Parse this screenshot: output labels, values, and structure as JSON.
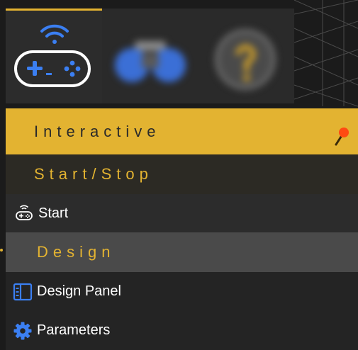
{
  "toolbar": {
    "buttons": [
      {
        "icon": "gamepad-icon",
        "active": true
      },
      {
        "icon": "binoculars-icon",
        "active": false
      },
      {
        "icon": "help-icon",
        "active": false
      }
    ]
  },
  "menu": {
    "interactive_label": "Interactive",
    "start_stop_label": "Start/Stop",
    "start_label": "Start",
    "design_label": "Design",
    "design_panel_label": "Design Panel",
    "parameters_label": "Parameters"
  },
  "colors": {
    "accent": "#e3b331",
    "icon_blue": "#3b7ff2",
    "pin_red": "#ff4a12"
  }
}
